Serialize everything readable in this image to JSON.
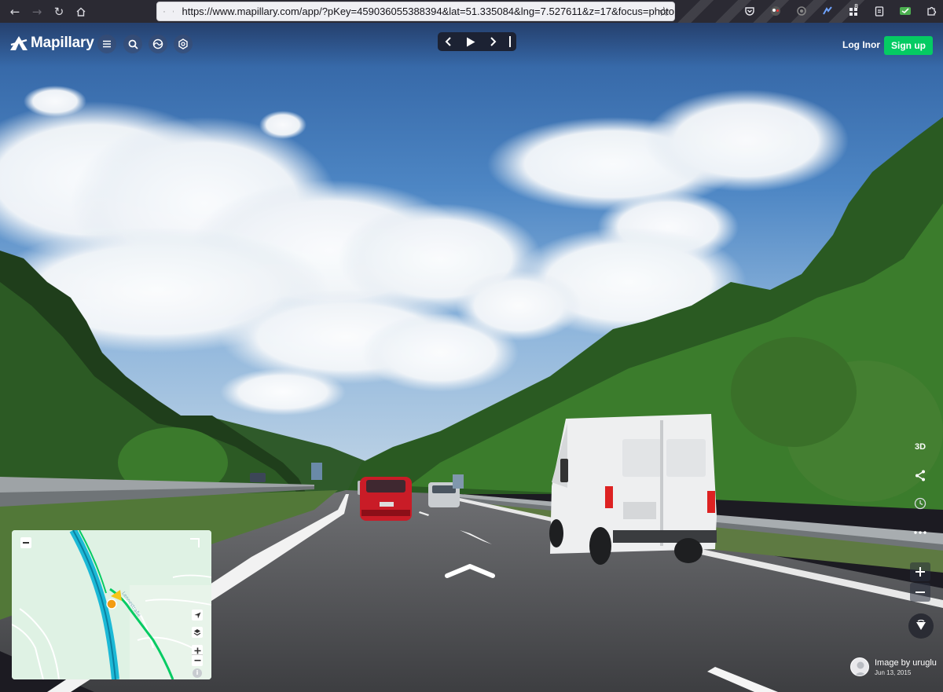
{
  "browser": {
    "url": "https://www.mapillary.com/app/?pKey=459036055388394&lat=51.335084&lng=7.527611&z=17&focus=photo",
    "toolbar_icons": [
      "back-icon",
      "forward-icon",
      "reload-icon",
      "home-icon",
      "shield-icon",
      "lock-icon",
      "bookmark-star-icon"
    ],
    "extensions": [
      "pocket-icon",
      "ublock-icon",
      "extension-icon",
      "bitwarden-icon",
      "counter-icon",
      "clipboard-icon",
      "reader-icon",
      "puzzle-icon",
      "menu-icon"
    ],
    "extension_badge": "8"
  },
  "app": {
    "logo_text": "Mapillary",
    "header_buttons": [
      "menu-icon",
      "search-icon",
      "map-style-icon",
      "settings-icon"
    ],
    "sequence_controls": [
      "prev-icon",
      "play-icon",
      "next-icon",
      "stop-icon"
    ],
    "login_label": "Log In",
    "or_label": "or",
    "signup_label": "Sign up",
    "accent_color": "#05cb63"
  },
  "side_controls": {
    "three_d_label": "3D",
    "icons": [
      "share-icon",
      "history-icon",
      "more-icon",
      "zoom-in-icon",
      "zoom-out-icon",
      "compass-icon"
    ]
  },
  "minimap": {
    "buttons": [
      "collapse-icon",
      "expand-corner-icon",
      "locate-icon",
      "layers-icon",
      "zoom-in-icon",
      "zoom-out-icon",
      "info-icon"
    ],
    "road_color": "#1cb9d6",
    "sequence_color": "#05cb63",
    "marker_color": "#f39c12"
  },
  "attribution": {
    "text": "Image by uruglu",
    "date": "Jun 13, 2015"
  }
}
